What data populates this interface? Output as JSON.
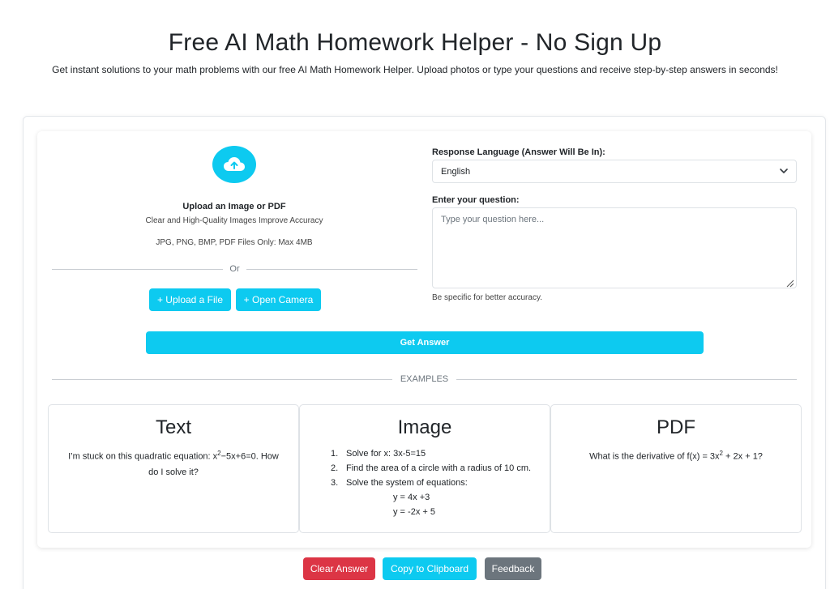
{
  "header": {
    "title": "Free AI Math Homework Helper - No Sign Up",
    "subtitle": "Get instant solutions to your math problems with our free AI Math Homework Helper. Upload photos or type your questions and receive step-by-step answers in seconds!"
  },
  "upload": {
    "icon": "cloud-upload-icon",
    "title": "Upload an Image or PDF",
    "hint": "Clear and High-Quality Images Improve Accuracy",
    "types": "JPG, PNG, BMP, PDF Files Only: Max 4MB",
    "or_text": "Or",
    "upload_file_label": "+ Upload a File",
    "open_camera_label": "+ Open Camera"
  },
  "language": {
    "label": "Response Language (Answer Will Be In):",
    "selected": "English"
  },
  "question": {
    "label": "Enter your question:",
    "placeholder": "Type your question here...",
    "value": "",
    "help": "Be specific for better accuracy."
  },
  "actions": {
    "get_answer_label": "Get Answer",
    "clear_label": "Clear Answer",
    "copy_label": "Copy to Clipboard",
    "feedback_label": "Feedback"
  },
  "examples": {
    "divider_label": "EXAMPLES",
    "text_card": {
      "title": "Text",
      "body_prefix": "I’m stuck on this quadratic equation: x",
      "body_sup": "2",
      "body_suffix": "−5x+6=0. How do I solve it?"
    },
    "image_card": {
      "title": "Image",
      "items": [
        {
          "num": "1.",
          "text": "Solve for x: 3x-5=15"
        },
        {
          "num": "2.",
          "text": "Find the area of a circle with a radius of 10 cm."
        },
        {
          "num": "3.",
          "text": "Solve the system of equations:"
        }
      ],
      "equations": [
        "y = 4x +3",
        "y = -2x + 5"
      ]
    },
    "pdf_card": {
      "title": "PDF",
      "body_prefix": "What is the derivative of f(x) = 3x",
      "body_sup": "2",
      "body_suffix": " + 2x + 1?"
    }
  },
  "colors": {
    "info": "#0dcaf0",
    "danger": "#dc3545",
    "secondary": "#6c757d"
  }
}
